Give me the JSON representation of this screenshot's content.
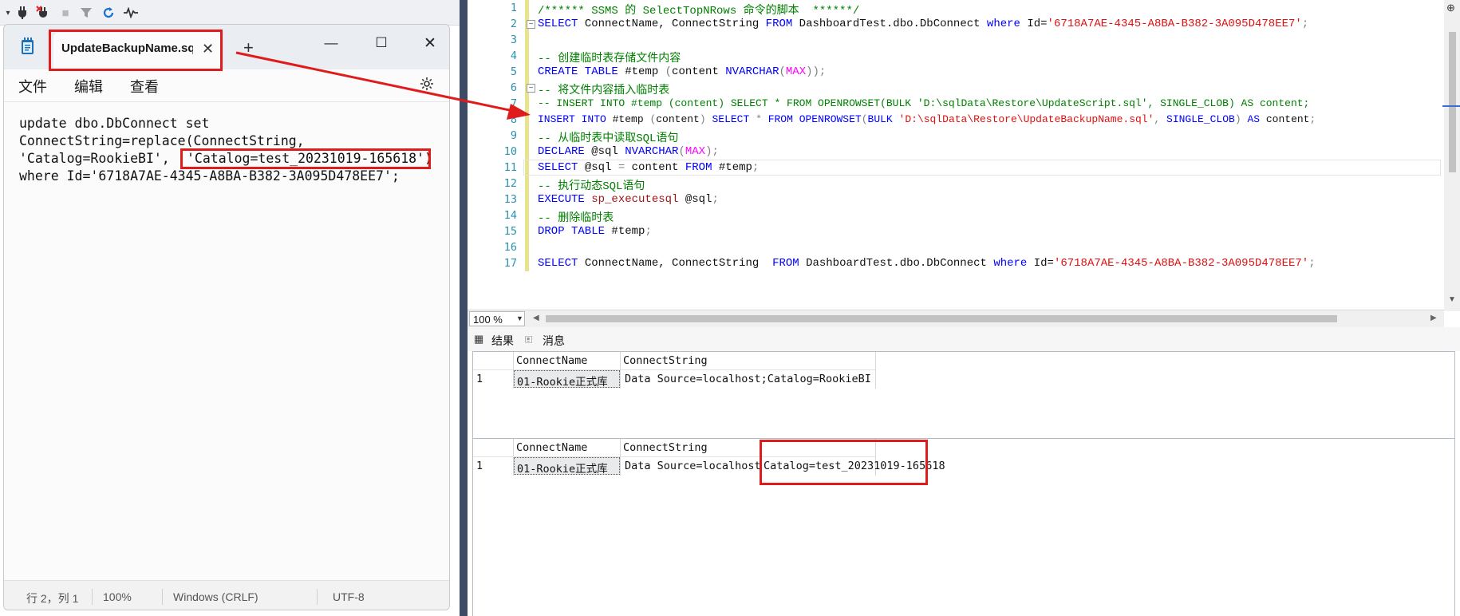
{
  "toolbar": {
    "icons": [
      "dropdown-icon",
      "connect-icon",
      "disconnect-icon",
      "stop-icon",
      "filter-icon",
      "refresh-icon",
      "activity-icon"
    ]
  },
  "notepad": {
    "tab_title": "UpdateBackupName.sql",
    "new_tab": "+",
    "menu": [
      "文件",
      "编辑",
      "查看"
    ],
    "content_lines": [
      "update dbo.DbConnect set",
      "ConnectString=replace(ConnectString,",
      "'Catalog=RookieBI',",
      "'Catalog=test_20231019-165618')",
      "where Id='6718A7AE-4345-A8BA-B382-3A095D478EE7';"
    ],
    "status": {
      "position": "行 2，列 1",
      "zoom": "100%",
      "line_ending": "Windows (CRLF)",
      "encoding": "UTF-8"
    }
  },
  "sql_editor": {
    "line_numbers": [
      "1",
      "2",
      "3",
      "4",
      "5",
      "6",
      "7",
      "8",
      "9",
      "10",
      "11",
      "12",
      "13",
      "14",
      "15",
      "16",
      "17"
    ],
    "lines": {
      "l1": "/****** SSMS 的 SelectTopNRows 命令的脚本  ******/",
      "l2a": "SELECT",
      "l2b": " ConnectName, ConnectString ",
      "l2c": "FROM",
      "l2d": " DashboardTest.dbo.DbConnect ",
      "l2e": "where",
      "l2f": " Id=",
      "l2g": "'6718A7AE-4345-A8BA-B382-3A095D478EE7'",
      "l2h": ";",
      "l4": "-- 创建临时表存储文件内容",
      "l5a": "CREATE TABLE",
      "l5b": " #temp ",
      "l5c": "(",
      "l5d": "content ",
      "l5e": "NVARCHAR",
      "l5f": "(",
      "l5g": "MAX",
      "l5h": "));",
      "l6": "-- 将文件内容插入临时表",
      "l7": "-- INSERT INTO #temp (content) SELECT * FROM OPENROWSET(BULK 'D:\\sqlData\\Restore\\UpdateScript.sql', SINGLE_CLOB) AS content;",
      "l8a": "INSERT INTO",
      "l8b": " #temp ",
      "l8c": "(",
      "l8d": "content",
      "l8e": ") ",
      "l8f": "SELECT",
      "l8g": " * ",
      "l8h": "FROM OPENROWSET",
      "l8i": "(",
      "l8j": "BULK ",
      "l8k": "'D:\\sqlData\\Restore\\UpdateBackupName.sql'",
      "l8l": ", ",
      "l8m": "SINGLE_CLOB",
      "l8n": ") ",
      "l8o": "AS",
      "l8p": " content",
      "l8q": ";",
      "l9": "-- 从临时表中读取SQL语句",
      "l10a": "DECLARE",
      "l10b": " @sql ",
      "l10c": "NVARCHAR",
      "l10d": "(",
      "l10e": "MAX",
      "l10f": ");",
      "l11a": "SELECT",
      "l11b": " @sql ",
      "l11c": "=",
      "l11d": " content ",
      "l11e": "FROM",
      "l11f": " #temp",
      "l11g": ";",
      "l12": "-- 执行动态SQL语句",
      "l13a": "EXECUTE",
      "l13b": " sp_executesql",
      "l13c": " @sql",
      "l13d": ";",
      "l14": "-- 删除临时表",
      "l15a": "DROP TABLE",
      "l15b": " #temp",
      "l15c": ";",
      "l17a": "SELECT",
      "l17b": " ConnectName, ConnectString  ",
      "l17c": "FROM",
      "l17d": " DashboardTest.dbo.DbConnect ",
      "l17e": "where",
      "l17f": " Id=",
      "l17g": "'6718A7AE-4345-A8BA-B382-3A095D478EE7'",
      "l17h": ";"
    },
    "zoom": "100 %"
  },
  "results": {
    "tab_results": "结果",
    "tab_messages": "消息",
    "grid1": {
      "headers": [
        "ConnectName",
        "ConnectString"
      ],
      "row_num": "1",
      "connect_name": "01-Rookie正式库",
      "connect_string": "Data Source=localhost;Catalog=RookieBI"
    },
    "grid2": {
      "headers": [
        "ConnectName",
        "ConnectString"
      ],
      "row_num": "1",
      "connect_name": "01-Rookie正式库",
      "connect_string_a": "Data Source=localhost",
      "connect_string_b": "Catalog=test_20231019-165618"
    }
  },
  "colors": {
    "annotation": "#e01b1b",
    "keyword": "#0000ff",
    "string": "#e01010",
    "comment": "#008000"
  }
}
